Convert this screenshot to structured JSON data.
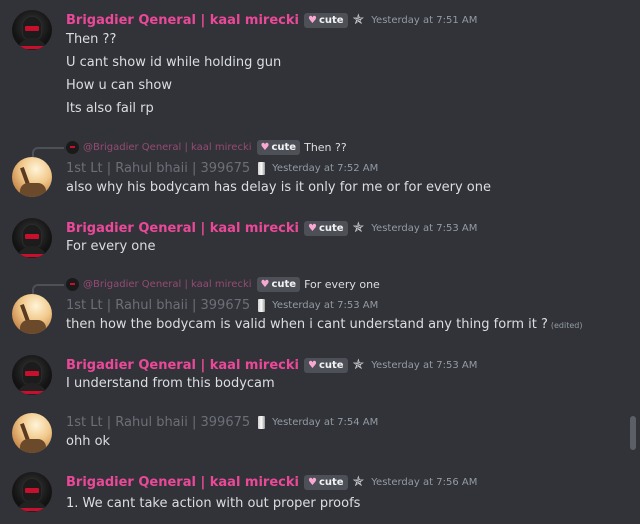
{
  "users": {
    "brigadier": "Brigadier Qeneral | kaal mirecki",
    "rahul": "1st Lt  | Rahul bhaii | 399675",
    "reply_brigadier": "@Brigadier Qeneral | kaal mirecki"
  },
  "tag_label": "cute",
  "messages": [
    {
      "time": "Yesterday at 7:51 AM",
      "lines": [
        "Then ??",
        "U cant show id while holding gun",
        "How u can show",
        "Its also fail rp"
      ]
    },
    {
      "reply_text": "Then ??",
      "time": "Yesterday at 7:52 AM",
      "lines": [
        "also why his bodycam has delay is it only for me or for every one"
      ]
    },
    {
      "time": "Yesterday at 7:53 AM",
      "lines": [
        "For every one"
      ]
    },
    {
      "reply_text": "For every one",
      "time": "Yesterday at 7:53 AM",
      "lines": [
        "then how the bodycam is valid when i cant understand any thing form it ?"
      ],
      "edited": "(edited)"
    },
    {
      "time": "Yesterday at 7:53 AM",
      "lines": [
        "I understand from this bodycam"
      ]
    },
    {
      "time": "Yesterday at 7:54 AM",
      "lines": [
        "ohh ok"
      ]
    },
    {
      "time": "Yesterday at 7:56 AM",
      "lines": [
        "1. We cant take action with out  proper proofs"
      ]
    }
  ],
  "colors": {
    "background": "#313338",
    "username_accent": "#ec4899",
    "tag_bg": "#4e5058"
  }
}
